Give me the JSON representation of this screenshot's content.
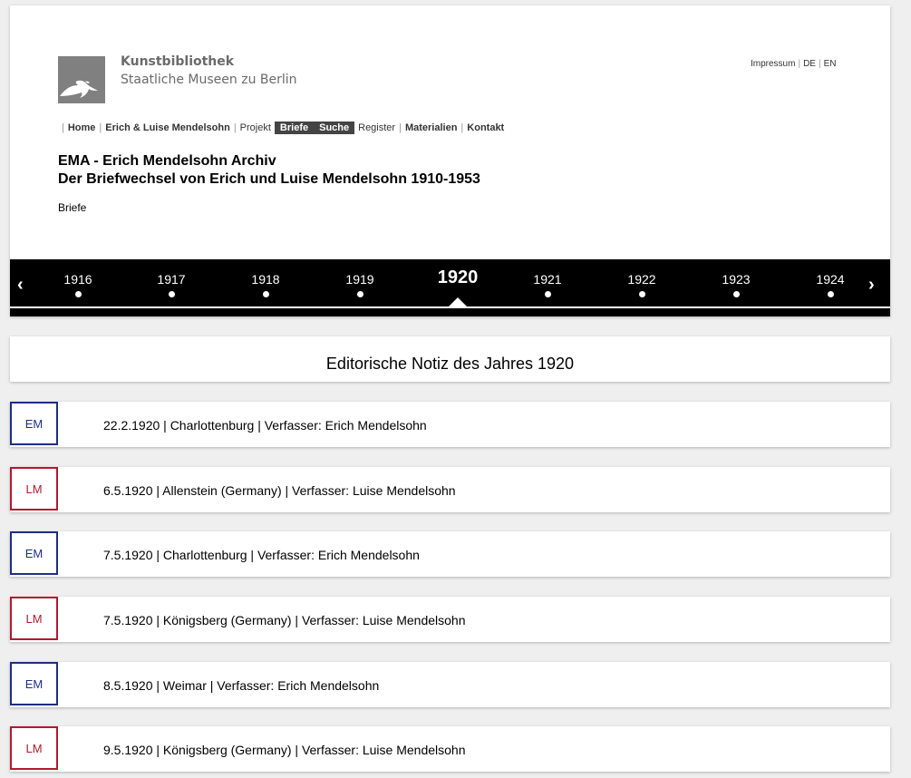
{
  "brand": {
    "line1": "Kunstbibliothek",
    "line2": "Staatliche Museen zu Berlin"
  },
  "lang": {
    "impressum": "Impressum",
    "de": "DE",
    "en": "EN"
  },
  "nav": {
    "home": "Home",
    "mendelsohn": "Erich & Luise Mendelsohn",
    "projekt": "Projekt",
    "briefe": "Briefe",
    "suche": "Suche",
    "register": "Register",
    "materialien": "Materialien",
    "kontakt": "Kontakt"
  },
  "title": {
    "line1": "EMA - Erich Mendelsohn Archiv",
    "line2": "Der Briefwechsel von Erich und Luise Mendelsohn 1910-1953"
  },
  "section_label": "Briefe",
  "timeline": {
    "prev": "‹",
    "next": "›",
    "active_year": "1920",
    "years": [
      "1916",
      "1917",
      "1918",
      "1919",
      "1920",
      "1921",
      "1922",
      "1923",
      "1924"
    ]
  },
  "note": "Editorische Notiz des Jahres 1920",
  "letters": [
    {
      "initials": "EM",
      "text": "22.2.1920 | Charlottenburg | Verfasser: Erich Mendelsohn"
    },
    {
      "initials": "LM",
      "text": "6.5.1920 | Allenstein (Germany) | Verfasser: Luise Mendelsohn"
    },
    {
      "initials": "EM",
      "text": "7.5.1920 | Charlottenburg | Verfasser: Erich Mendelsohn"
    },
    {
      "initials": "LM",
      "text": "7.5.1920 | Königsberg (Germany) | Verfasser: Luise Mendelsohn"
    },
    {
      "initials": "EM",
      "text": "8.5.1920 | Weimar | Verfasser: Erich Mendelsohn"
    },
    {
      "initials": "LM",
      "text": "9.5.1920 | Königsberg (Germany) | Verfasser: Luise Mendelsohn"
    }
  ],
  "colors": {
    "em": "#1d2e86",
    "lm": "#b01a2f",
    "nav_active_bg": "#444444",
    "timeline_bg": "#000000"
  }
}
